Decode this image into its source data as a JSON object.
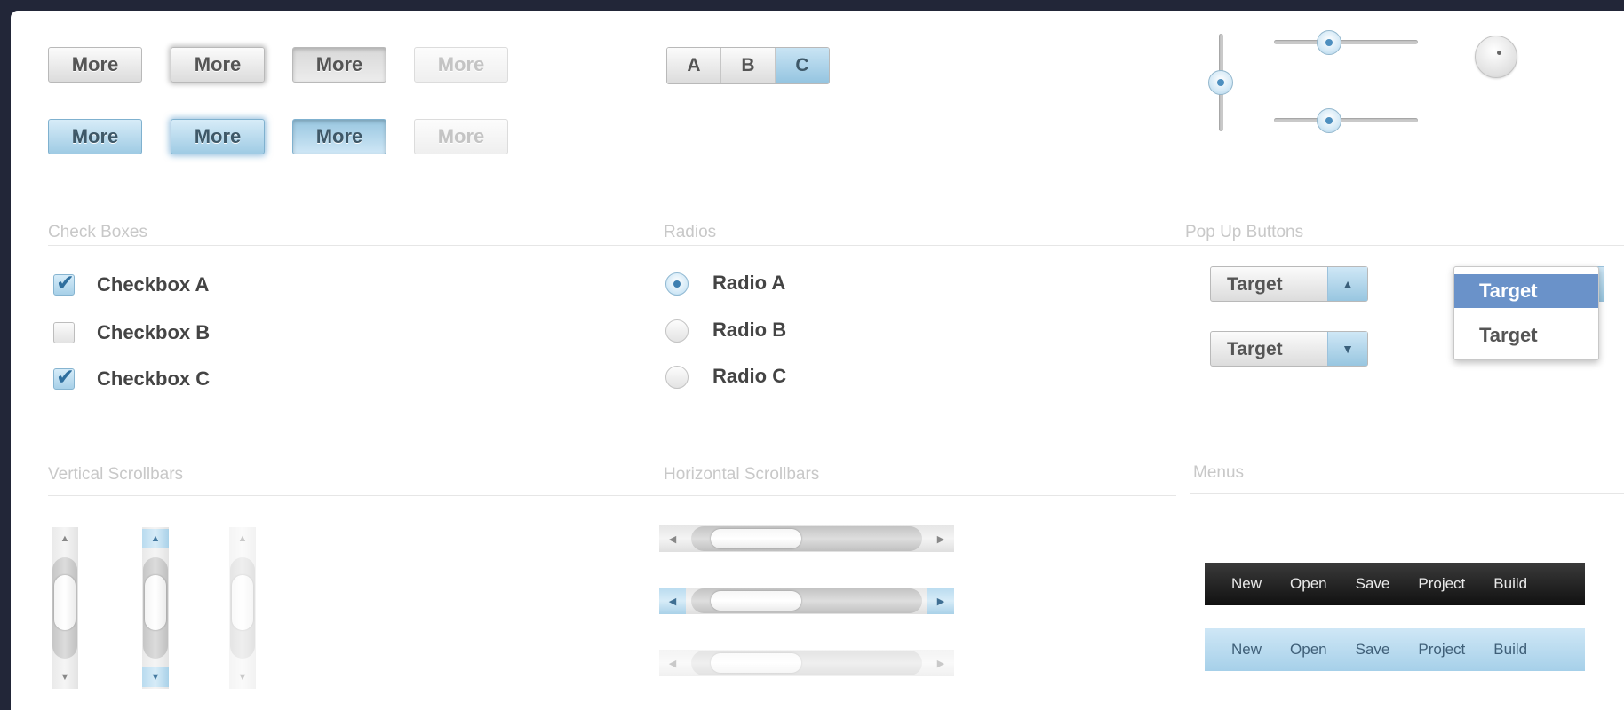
{
  "buttons": {
    "row1": [
      "More",
      "More",
      "More",
      "More"
    ],
    "row2": [
      "More",
      "More",
      "More",
      "More"
    ]
  },
  "segmented": [
    "A",
    "B",
    "C"
  ],
  "segmented_selected": "C",
  "slider_levels": {
    "vertical": 0.5,
    "horizontal_top": 0.38,
    "horizontal_bottom": 0.38
  },
  "sections": {
    "checkboxes": "Check Boxes",
    "radios": "Radios",
    "popups": "Pop Up Buttons",
    "vscroll": "Vertical Scrollbars",
    "hscroll": "Horizontal Scrollbars",
    "menus": "Menus"
  },
  "checkboxes": [
    {
      "label": "Checkbox A",
      "checked": true
    },
    {
      "label": "Checkbox B",
      "checked": false
    },
    {
      "label": "Checkbox C",
      "checked": true
    }
  ],
  "radios": [
    {
      "label": "Radio A",
      "selected": true
    },
    {
      "label": "Radio B",
      "selected": false
    },
    {
      "label": "Radio C",
      "selected": false
    }
  ],
  "popups": {
    "stepper_value": "Target",
    "dropdown_value": "Target",
    "open_menu": [
      "Target",
      "Target"
    ]
  },
  "menus": {
    "dark": [
      "New",
      "Open",
      "Save",
      "Project",
      "Build"
    ],
    "light": [
      "New",
      "Open",
      "Save",
      "Project",
      "Build"
    ]
  },
  "colors": {
    "accent_blue": "#9fcbe4",
    "selection_blue": "#6a92c9",
    "dark_menubar": "#111111",
    "window_frame": "#222638"
  }
}
